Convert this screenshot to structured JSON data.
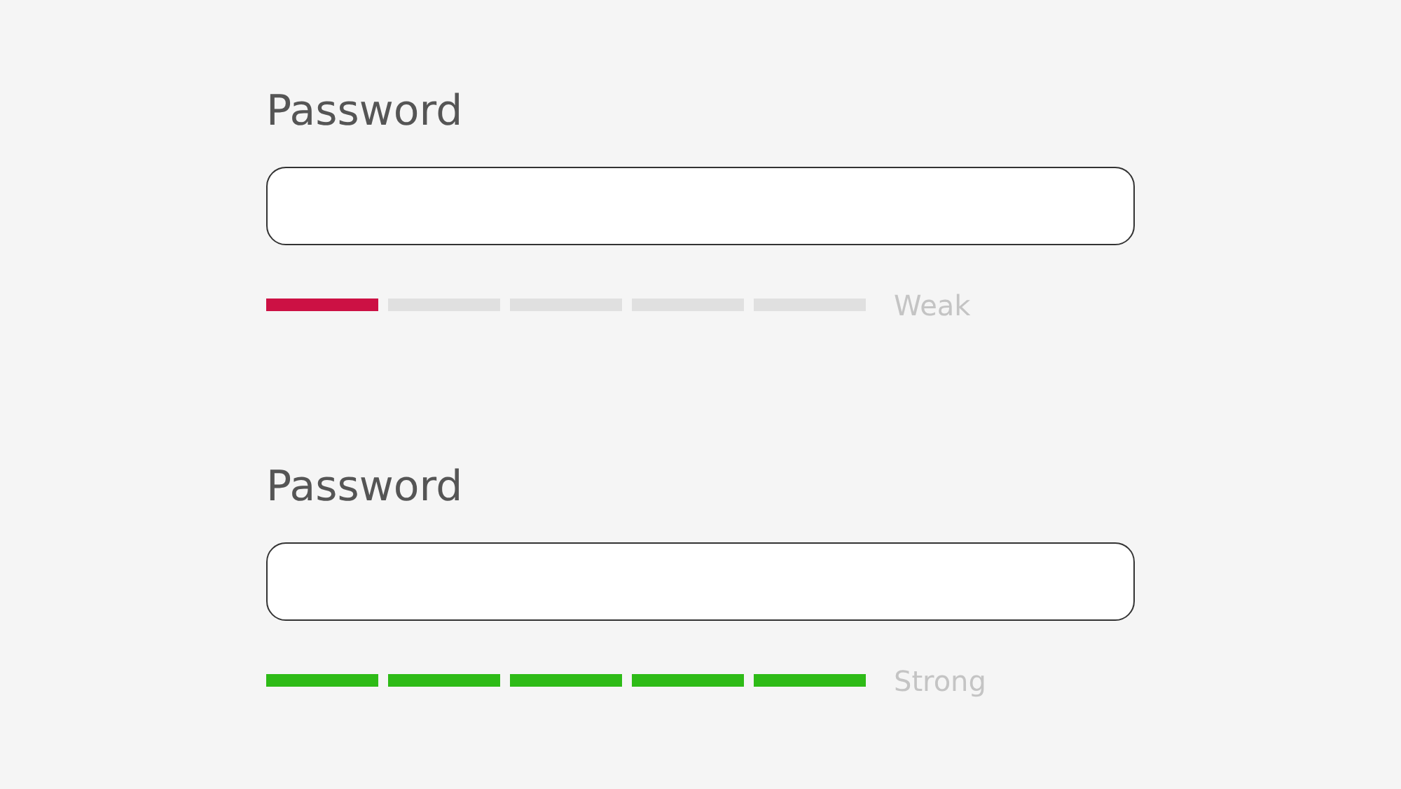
{
  "fields": [
    {
      "label": "Password",
      "color": "#cc1144",
      "segments": [
        {
          "on": true
        },
        {
          "on": false
        },
        {
          "on": false
        },
        {
          "on": false
        },
        {
          "on": false
        }
      ],
      "strength_label": "Weak"
    },
    {
      "label": "Password",
      "color": "#2ebb17",
      "segments": [
        {
          "on": true
        },
        {
          "on": true
        },
        {
          "on": true
        },
        {
          "on": true
        },
        {
          "on": true
        }
      ],
      "strength_label": "Strong"
    }
  ]
}
